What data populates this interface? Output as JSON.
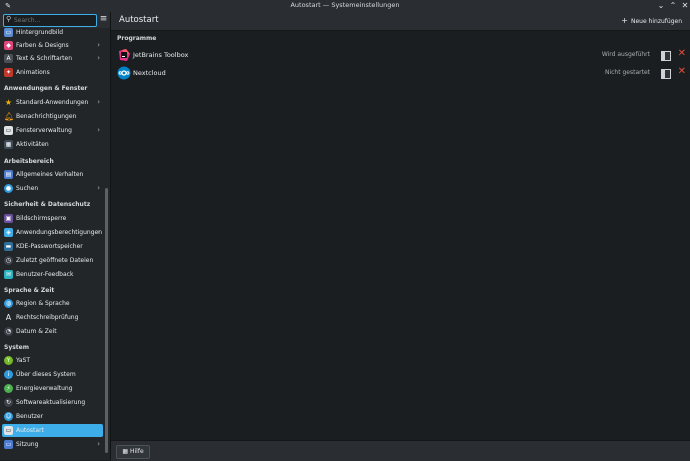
{
  "window": {
    "title": "Autostart — Systemeinstellungen"
  },
  "sidebar": {
    "search_placeholder": "Search...",
    "items": [
      {
        "label": "Hintergrundbild",
        "icon": "wallpaper-icon",
        "color": "#5b8bd0"
      },
      {
        "label": "Farben & Designs",
        "icon": "palette-icon",
        "color": "#e0457b",
        "chevron": true
      },
      {
        "label": "Text & Schriftarten",
        "icon": "font-icon",
        "color": "#4a4f55",
        "chevron": true
      },
      {
        "label": "Animations",
        "icon": "animation-icon",
        "color": "#c0392b"
      },
      {
        "label": "Standard-Anwendungen",
        "icon": "star-icon",
        "color": "#f0b400",
        "chevron": true
      },
      {
        "label": "Benachrichtigungen",
        "icon": "bell-icon",
        "color": "#f39c12"
      },
      {
        "label": "Fensterverwaltung",
        "icon": "window-icon",
        "color": "#dfe3e6",
        "chevron": true
      },
      {
        "label": "Aktivitäten",
        "icon": "activities-icon",
        "color": "#3d4a57"
      },
      {
        "label": "Allgemeines Verhalten",
        "icon": "general-behavior-icon",
        "color": "#4a7bd0"
      },
      {
        "label": "Suchen",
        "icon": "search-globe-icon",
        "color": "#2e9be0",
        "chevron": true
      },
      {
        "label": "Bildschirmsperre",
        "icon": "screen-lock-icon",
        "color": "#6a4fa0"
      },
      {
        "label": "Anwendungsberechtigungen",
        "icon": "shield-icon",
        "color": "#3daee9",
        "chevron": true
      },
      {
        "label": "KDE-Passwortspeicher",
        "icon": "wallet-icon",
        "color": "#2c6e9c"
      },
      {
        "label": "Zuletzt geöffnete Dateien",
        "icon": "recent-files-icon",
        "color": "#3b4148"
      },
      {
        "label": "Benutzer-Feedback",
        "icon": "feedback-icon",
        "color": "#2bb3c0"
      },
      {
        "label": "Region & Sprache",
        "icon": "globe-icon",
        "color": "#2e9be0"
      },
      {
        "label": "Rechtschreibprüfung",
        "icon": "spellcheck-icon",
        "color": "#232629"
      },
      {
        "label": "Datum & Zeit",
        "icon": "clock-icon",
        "color": "#3b4148"
      },
      {
        "label": "YaST",
        "icon": "yast-icon",
        "color": "#73ba25"
      },
      {
        "label": "Über dieses System",
        "icon": "info-icon",
        "color": "#2e9be0"
      },
      {
        "label": "Energieverwaltung",
        "icon": "battery-icon",
        "color": "#4caf50"
      },
      {
        "label": "Softwareaktualisierung",
        "icon": "update-icon",
        "color": "#3b4148"
      },
      {
        "label": "Benutzer",
        "icon": "user-icon",
        "color": "#2e9be0"
      },
      {
        "label": "Autostart",
        "icon": "autostart-icon",
        "color": "#dfe3e6",
        "active": true
      },
      {
        "label": "Sitzung",
        "icon": "session-icon",
        "color": "#4a7bd0",
        "chevron": true
      }
    ],
    "sections": {
      "apps_windows": "Anwendungen & Fenster",
      "workspace": "Arbeitsbereich",
      "security": "Sicherheit & Datenschutz",
      "language": "Sprache & Zeit",
      "system": "System"
    }
  },
  "main": {
    "title": "Autostart",
    "add_new_label": "Neue hinzufügen",
    "section_label": "Programme",
    "programs": [
      {
        "name": "JetBrains Toolbox",
        "status": "Wird ausgeführt",
        "icon": "jetbrains-toolbox-icon"
      },
      {
        "name": "Nextcloud",
        "status": "Nicht gestartet",
        "icon": "nextcloud-icon"
      }
    ],
    "help_label": "Hilfe"
  },
  "colors": {
    "accent": "#3daee9",
    "remove": "#e74c3c",
    "background": "#1b1e20",
    "sidebar": "#232629"
  }
}
